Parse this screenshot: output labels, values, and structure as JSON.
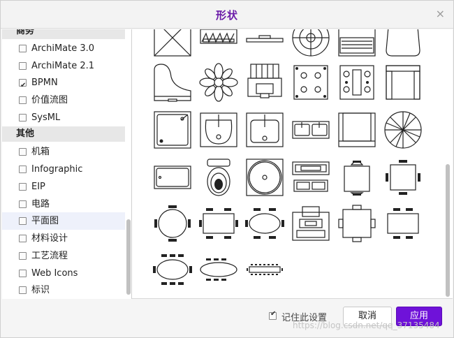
{
  "dialog": {
    "title": "形状",
    "close_glyph": "×",
    "remember_label": "记住此设置",
    "remember_checked": true,
    "cancel_label": "取消",
    "apply_label": "应用",
    "accent_color": "#6f12d9"
  },
  "sidebar": {
    "cut_category": "商务",
    "items_a": [
      {
        "label": "ArchiMate 3.0",
        "checked": false
      },
      {
        "label": "ArchiMate 2.1",
        "checked": false
      },
      {
        "label": "BPMN",
        "checked": true
      },
      {
        "label": "价值流图",
        "checked": false
      },
      {
        "label": "SysML",
        "checked": false
      }
    ],
    "category_other": "其他",
    "items_b": [
      {
        "label": "机箱",
        "checked": false
      },
      {
        "label": "Infographic",
        "checked": false
      },
      {
        "label": "EIP",
        "checked": false
      },
      {
        "label": "电路",
        "checked": false
      },
      {
        "label": "平面图",
        "checked": false,
        "highlighted": true
      },
      {
        "label": "材料设计",
        "checked": false
      },
      {
        "label": "工艺流程",
        "checked": false
      },
      {
        "label": "Web Icons",
        "checked": false
      },
      {
        "label": "标识",
        "checked": false
      }
    ]
  },
  "shapes": [
    "floorplan-crossed-box-icon",
    "floorplan-dresser-icon",
    "floorplan-shelf-icon",
    "floorplan-round-target-icon",
    "floorplan-laptop-icon",
    "floorplan-chair-back-icon",
    "floorplan-piano-icon",
    "floorplan-plant-icon",
    "floorplan-office-chair-icon",
    "floorplan-stove-4-icon",
    "floorplan-stove-range-icon",
    "floorplan-sofa-chair-icon",
    "floorplan-shower-icon",
    "floorplan-sink-icon",
    "floorplan-sink-square-icon",
    "floorplan-double-sink-icon",
    "floorplan-armchair-icon",
    "floorplan-umbrella-icon",
    "floorplan-bathtub-icon",
    "floorplan-toilet-icon",
    "floorplan-round-tub-icon",
    "floorplan-workstation-icon",
    "floorplan-table-2-icon",
    "floorplan-table-4-icon",
    "floorplan-round-table-4-icon",
    "floorplan-table-6-icon",
    "floorplan-oval-table-6-icon",
    "floorplan-desk-computer-icon",
    "floorplan-square-table-4-icon",
    "floorplan-table-rect-4-icon",
    "floorplan-oval-table-8-icon",
    "floorplan-oval-table-10-icon",
    "floorplan-long-table-icon"
  ],
  "watermark": "https://blog.csdn.net/qq_37135484"
}
